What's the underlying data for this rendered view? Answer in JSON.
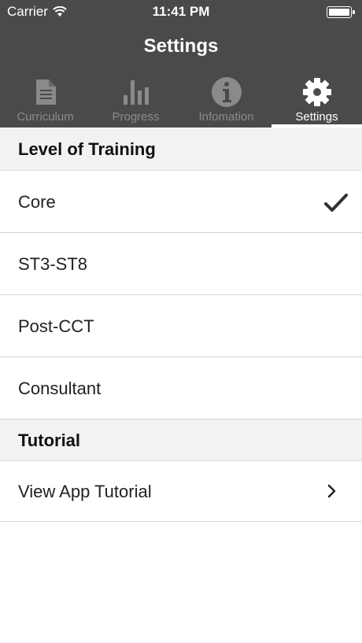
{
  "status_bar": {
    "carrier": "Carrier",
    "time": "11:41 PM"
  },
  "nav": {
    "title": "Settings"
  },
  "tabs": [
    {
      "label": "Curriculum",
      "icon": "document-icon",
      "active": false
    },
    {
      "label": "Progress",
      "icon": "bar-chart-icon",
      "active": false
    },
    {
      "label": "Infomation",
      "icon": "info-icon",
      "active": false
    },
    {
      "label": "Settings",
      "icon": "gear-icon",
      "active": true
    }
  ],
  "sections": {
    "training": {
      "header": "Level of Training",
      "options": [
        {
          "label": "Core",
          "selected": true
        },
        {
          "label": "ST3-ST8",
          "selected": false
        },
        {
          "label": "Post-CCT",
          "selected": false
        },
        {
          "label": "Consultant",
          "selected": false
        }
      ]
    },
    "tutorial": {
      "header": "Tutorial",
      "row_label": "View App Tutorial"
    }
  },
  "colors": {
    "header_bg": "#4a4a4a",
    "tab_inactive": "#8a8a8a",
    "tab_active": "#ffffff",
    "section_bg": "#f2f2f2"
  }
}
